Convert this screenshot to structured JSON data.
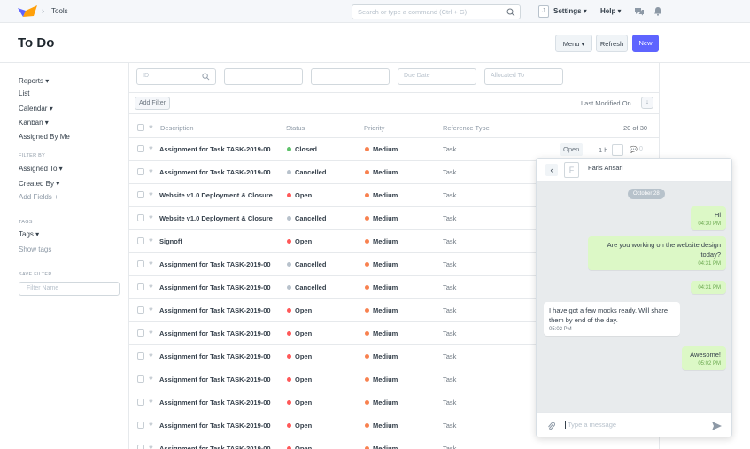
{
  "navbar": {
    "breadcrumb": "Tools",
    "search_placeholder": "Search or type a command (Ctrl + G)",
    "user_initial": "J",
    "settings": "Settings ▾",
    "help": "Help ▾"
  },
  "page": {
    "title": "To Do",
    "menu_btn": "Menu ▾",
    "refresh_btn": "Refresh",
    "new_btn": "New"
  },
  "sidebar": {
    "views": [
      "Reports ▾",
      "List",
      "Calendar ▾",
      "Kanban ▾",
      "Assigned By Me"
    ],
    "filter_by_label": "FILTER BY",
    "filters": [
      "Assigned To ▾",
      "Created By ▾"
    ],
    "add_fields": "Add Fields +",
    "tags_label": "TAGS",
    "tags": "Tags ▾",
    "show_tags": "Show tags",
    "save_filter_label": "SAVE FILTER",
    "filter_name_placeholder": "Filter Name"
  },
  "filters": {
    "id_placeholder": "ID",
    "due_date_placeholder": "Due Date",
    "allocated_to_placeholder": "Allocated To",
    "add_filter": "Add Filter",
    "sort_label": "Last Modified On"
  },
  "table": {
    "columns": [
      "Description",
      "Status",
      "Priority",
      "Reference Type"
    ],
    "count": "20 of 30",
    "status_colors": {
      "Closed": "#5ec26a",
      "Cancelled": "#b8c2cc",
      "Open": "#ff5858"
    },
    "rows": [
      {
        "desc": "Assignment for Task TASK-2019-00",
        "status": "Closed",
        "priority": "Medium",
        "ref": "Task"
      },
      {
        "desc": "Assignment for Task TASK-2019-00",
        "status": "Cancelled",
        "priority": "Medium",
        "ref": "Task"
      },
      {
        "desc": "Website v1.0 Deployment & Closure",
        "status": "Open",
        "priority": "Medium",
        "ref": "Task"
      },
      {
        "desc": "Website v1.0 Deployment & Closure",
        "status": "Cancelled",
        "priority": "Medium",
        "ref": "Task"
      },
      {
        "desc": "Signoff",
        "status": "Open",
        "priority": "Medium",
        "ref": "Task"
      },
      {
        "desc": "Assignment for Task TASK-2019-00",
        "status": "Cancelled",
        "priority": "Medium",
        "ref": "Task"
      },
      {
        "desc": "Assignment for Task TASK-2019-00",
        "status": "Cancelled",
        "priority": "Medium",
        "ref": "Task"
      },
      {
        "desc": "Assignment for Task TASK-2019-00",
        "status": "Open",
        "priority": "Medium",
        "ref": "Task"
      },
      {
        "desc": "Assignment for Task TASK-2019-00",
        "status": "Open",
        "priority": "Medium",
        "ref": "Task"
      },
      {
        "desc": "Assignment for Task TASK-2019-00",
        "status": "Open",
        "priority": "Medium",
        "ref": "Task"
      },
      {
        "desc": "Assignment for Task TASK-2019-00",
        "status": "Open",
        "priority": "Medium",
        "ref": "Task"
      },
      {
        "desc": "Assignment for Task TASK-2019-00",
        "status": "Open",
        "priority": "Medium",
        "ref": "Task"
      },
      {
        "desc": "Assignment for Task TASK-2019-00",
        "status": "Open",
        "priority": "Medium",
        "ref": "Task"
      },
      {
        "desc": "Assignment for Task TASK-2019-00",
        "status": "Open",
        "priority": "Medium",
        "ref": "Task"
      }
    ],
    "first_row_meta": {
      "tag": "Open",
      "time": "1 h",
      "comments": "0"
    }
  },
  "chat": {
    "avatar_initial": "F",
    "contact_name": "Faris Ansari",
    "date": "October 28",
    "messages": [
      {
        "side": "right",
        "text": "Hi",
        "time": "04:30 PM"
      },
      {
        "side": "right",
        "text": "Are you working on the website design today?",
        "time": "04:31 PM"
      },
      {
        "side": "right",
        "text": "",
        "time": "04:31 PM"
      },
      {
        "side": "left",
        "text": "I have got a few mocks ready. Will share them by end of the day.",
        "time": "05:02 PM"
      },
      {
        "side": "right",
        "text": "Awesome!",
        "time": "05:02 PM"
      }
    ],
    "input_placeholder": "Type a message"
  },
  "colors": {
    "accent": "#5e64ff",
    "priority_medium": "#f8814f",
    "bubble_out": "#dcf8c6"
  }
}
